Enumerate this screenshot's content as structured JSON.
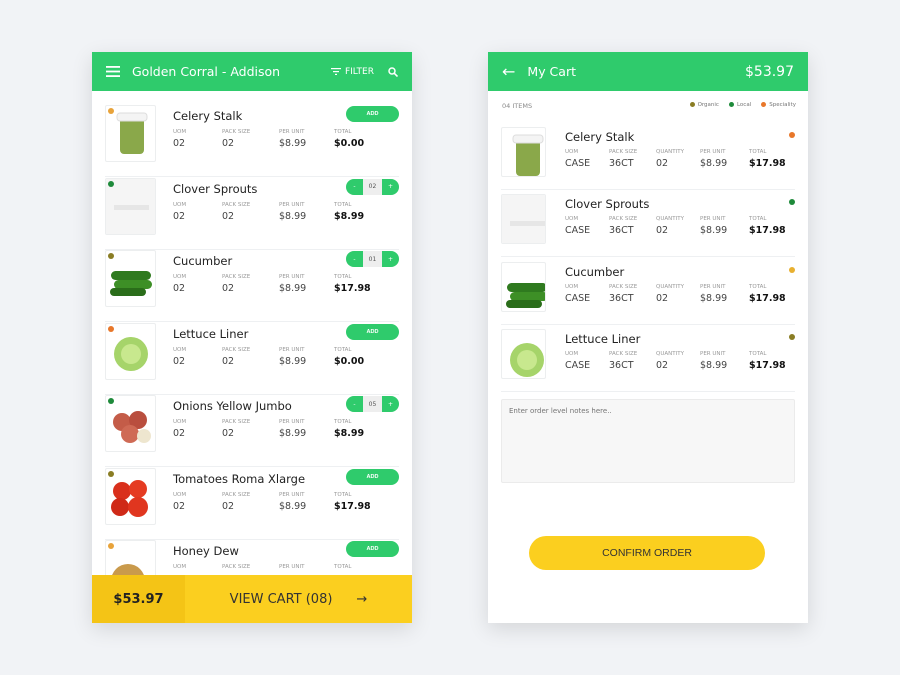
{
  "colors": {
    "green": "#2fcb6c",
    "yellow": "#fbcf1f",
    "organic": "#8a7d24",
    "local": "#1e8a3a",
    "speciality": "#e8772a",
    "amber": "#e8a33a"
  },
  "left": {
    "title": "Golden Corral - Addison",
    "filter_label": "FILTER",
    "labels": {
      "uom": "UOM",
      "pack": "PACK SIZE",
      "unit": "PER UNIT",
      "total": "TOTAL"
    },
    "add_label": "ADD",
    "items": [
      {
        "name": "Celery Stalk",
        "uom": "02",
        "pack": "02",
        "unit": "$8.99",
        "total": "$0.00",
        "qty": null,
        "dot": "#e8a33a",
        "img": "celery"
      },
      {
        "name": "Clover Sprouts",
        "uom": "02",
        "pack": "02",
        "unit": "$8.99",
        "total": "$8.99",
        "qty": "02",
        "dot": "#1e8a3a",
        "img": "blank"
      },
      {
        "name": "Cucumber",
        "uom": "02",
        "pack": "02",
        "unit": "$8.99",
        "total": "$17.98",
        "qty": "01",
        "dot": "#8a7d24",
        "img": "cucumber"
      },
      {
        "name": "Lettuce Liner",
        "uom": "02",
        "pack": "02",
        "unit": "$8.99",
        "total": "$0.00",
        "qty": null,
        "dot": "#e8772a",
        "img": "lettuce"
      },
      {
        "name": "Onions Yellow Jumbo",
        "uom": "02",
        "pack": "02",
        "unit": "$8.99",
        "total": "$8.99",
        "qty": "05",
        "dot": "#1e8a3a",
        "img": "onion"
      },
      {
        "name": "Tomatoes Roma Xlarge",
        "uom": "02",
        "pack": "02",
        "unit": "$8.99",
        "total": "$17.98",
        "qty": null,
        "dot": "#8a7d24",
        "img": "tomato"
      },
      {
        "name": "Honey Dew",
        "uom": "",
        "pack": "",
        "unit": "",
        "total": "",
        "qty": null,
        "dot": "#e8a33a",
        "img": "melon"
      }
    ],
    "bottom": {
      "price": "$53.97",
      "view_cart": "VIEW CART (08)"
    }
  },
  "right": {
    "title": "My Cart",
    "total": "$53.97",
    "count": "04 ITEMS",
    "legend": [
      {
        "label": "Organic",
        "color": "#8a7d24"
      },
      {
        "label": "Local",
        "color": "#1e8a3a"
      },
      {
        "label": "Speciality",
        "color": "#e8772a"
      }
    ],
    "labels": {
      "uom": "UOM",
      "pack": "PACK SIZE",
      "qty": "QUANTITY",
      "unit": "PER UNIT",
      "total": "TOTAL"
    },
    "items": [
      {
        "name": "Celery Stalk",
        "uom": "CASE",
        "pack": "36CT",
        "qty": "02",
        "unit": "$8.99",
        "total": "$17.98",
        "dot": "#e8772a",
        "img": "celery"
      },
      {
        "name": "Clover Sprouts",
        "uom": "CASE",
        "pack": "36CT",
        "qty": "02",
        "unit": "$8.99",
        "total": "$17.98",
        "dot": "#1e8a3a",
        "img": "blank"
      },
      {
        "name": "Cucumber",
        "uom": "CASE",
        "pack": "36CT",
        "qty": "02",
        "unit": "$8.99",
        "total": "$17.98",
        "dot": "#e8b030",
        "img": "cucumber"
      },
      {
        "name": "Lettuce Liner",
        "uom": "CASE",
        "pack": "36CT",
        "qty": "02",
        "unit": "$8.99",
        "total": "$17.98",
        "dot": "#8a7d24",
        "img": "lettuce"
      }
    ],
    "notes_placeholder": "Enter order level notes here..",
    "confirm_label": "CONFIRM ORDER"
  }
}
